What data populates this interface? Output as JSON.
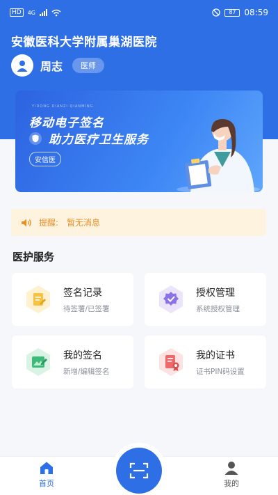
{
  "status_bar": {
    "time": "08:59",
    "battery": "87",
    "network_label": "HD",
    "speed": "4G"
  },
  "header": {
    "hospital_name": "安徽医科大学附属巢湖医院",
    "user_name": "周志",
    "role": "医师"
  },
  "banner": {
    "tiny_text": "YIDONG DIANZI QIANMING",
    "line1": "移动电子签名",
    "line2": "助力医疗卫生服务",
    "tag": "安信医"
  },
  "notice": {
    "label": "提醒:",
    "message": "暂无消息"
  },
  "services": {
    "title": "医护服务",
    "items": [
      {
        "title": "签名记录",
        "subtitle": "待签署/已签署",
        "icon": "sign-record-icon",
        "color": "#f5c242"
      },
      {
        "title": "授权管理",
        "subtitle": "系统授权管理",
        "icon": "authorization-icon",
        "color": "#8a72e8"
      },
      {
        "title": "我的签名",
        "subtitle": "新增/编辑签名",
        "icon": "my-signature-icon",
        "color": "#3fb97a"
      },
      {
        "title": "我的证书",
        "subtitle": "证书PIN码设置",
        "icon": "certificate-icon",
        "color": "#ee6a6a"
      }
    ]
  },
  "bottom_nav": {
    "home_label": "首页",
    "mine_label": "我的",
    "active": "home",
    "accent": "#2f6fe6"
  }
}
